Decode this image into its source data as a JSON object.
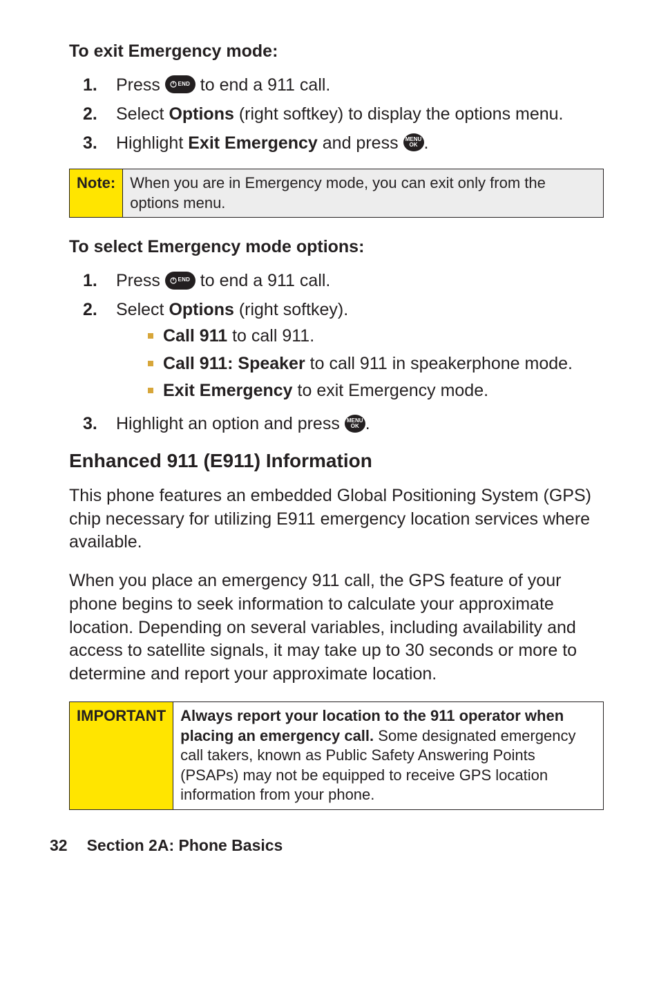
{
  "heading1": "To exit Emergency mode:",
  "steps1": {
    "s1_a": "Press ",
    "s1_b": " to end a 911 call.",
    "s2_a": "Select ",
    "s2_opt": "Options",
    "s2_b": " (right softkey) to display the options menu.",
    "s3_a": "Highlight ",
    "s3_exit": "Exit Emergency",
    "s3_b": " and press ",
    "s3_c": "."
  },
  "note": {
    "label": "Note:",
    "body": "When you are in Emergency mode, you can exit only from the options menu."
  },
  "heading2": "To select Emergency mode options:",
  "steps2": {
    "s1_a": "Press ",
    "s1_b": " to end a 911 call.",
    "s2_a": "Select ",
    "s2_opt": "Options",
    "s2_b": " (right softkey).",
    "sub1_bold": "Call 911",
    "sub1_rest": " to call 911.",
    "sub2_bold": "Call 911: Speaker",
    "sub2_rest": " to call 911 in speakerphone mode.",
    "sub3_bold": "Exit Emergency",
    "sub3_rest": " to exit Emergency mode.",
    "s3_a": "Highlight an option and press ",
    "s3_b": "."
  },
  "section_heading": "Enhanced 911 (E911) Information",
  "para1": "This phone features an embedded Global Positioning System (GPS) chip necessary for utilizing E911 emergency location services where available.",
  "para2": "When you place an emergency 911 call, the GPS feature of your phone begins to seek information to calculate your approximate location. Depending on several variables, including availability and access to satellite signals, it may take up to 30 seconds or more to determine and report your approximate location.",
  "important": {
    "label": "IMPORTANT",
    "bold1": "Always report your location to the 911 operator when placing an emergency call.",
    "rest": " Some designated emergency call takers, known as Public Safety Answering Points (PSAPs) may not be equipped to receive GPS location information from your phone."
  },
  "footer": {
    "page": "32",
    "section": "Section 2A: Phone Basics"
  },
  "icons": {
    "end_text": "END",
    "menu_top": "MENU",
    "menu_bot": "OK"
  },
  "nums": {
    "n1": "1.",
    "n2": "2.",
    "n3": "3."
  }
}
